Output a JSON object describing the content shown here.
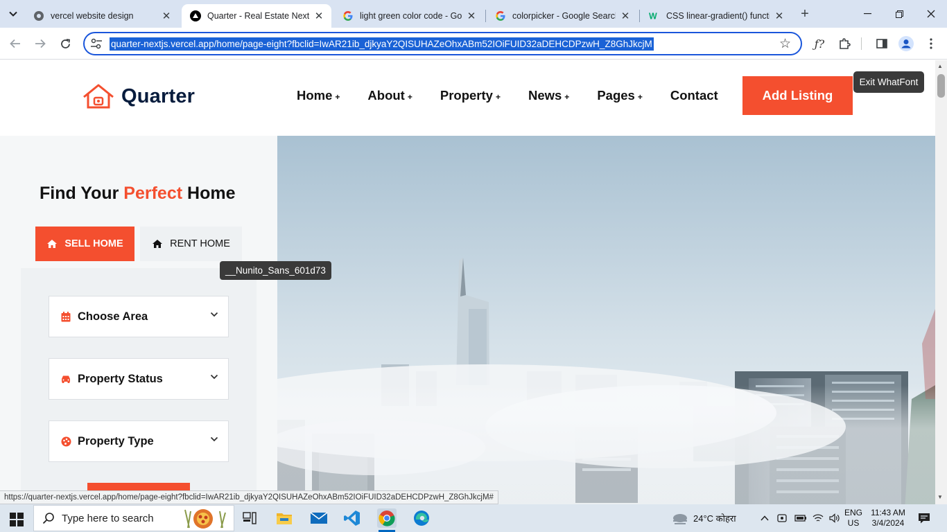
{
  "browser": {
    "tabs": [
      {
        "title": "vercel website design",
        "icon": "globe-icon",
        "active": false
      },
      {
        "title": "Quarter - Real Estate NextJs",
        "icon": "vercel-icon",
        "active": true
      },
      {
        "title": "light green color code - Goo",
        "icon": "google-icon",
        "active": false
      },
      {
        "title": "colorpicker - Google Search",
        "icon": "google-icon",
        "active": false
      },
      {
        "title": "CSS linear-gradient() functio",
        "icon": "w3schools-icon",
        "active": false
      }
    ],
    "url": "quarter-nextjs.vercel.app/home/page-eight?fbclid=IwAR21ib_djkyaY2QISUHAZeOhxABm52IOiFUID32aDEHCDPzwH_Z8GhJkcjM",
    "status_url": "https://quarter-nextjs.vercel.app/home/page-eight?fbclid=IwAR21ib_djkyaY2QISUHAZeOhxABm52IOiFUID32aDEHCDPzwH_Z8GhJkcjM#"
  },
  "site": {
    "logo_text": "Quarter",
    "nav": [
      {
        "label": "Home",
        "has_sub": true
      },
      {
        "label": "About",
        "has_sub": true
      },
      {
        "label": "Property",
        "has_sub": true
      },
      {
        "label": "News",
        "has_sub": true
      },
      {
        "label": "Pages",
        "has_sub": true
      },
      {
        "label": "Contact",
        "has_sub": false
      }
    ],
    "nav_plus": "+",
    "add_listing": "Add Listing",
    "hero": {
      "title_pre": "Find Your ",
      "title_accent": "Perfect",
      "title_post": " Home",
      "tab_sell": "SELL HOME",
      "tab_rent": "RENT HOME",
      "selects": [
        {
          "label": "Choose Area",
          "icon": "calendar-icon"
        },
        {
          "label": "Property Status",
          "icon": "car-icon"
        },
        {
          "label": "Property Type",
          "icon": "palette-icon"
        }
      ]
    },
    "accent_color": "#f44f2f",
    "dark_color": "#071c3d"
  },
  "whatfont": {
    "tooltip": "__Nunito_Sans_601d73",
    "exit": "Exit WhatFont"
  },
  "taskbar": {
    "search_placeholder": "Type here to search",
    "weather": "24°C कोहरा",
    "lang1": "ENG",
    "lang2": "US",
    "time": "11:43 AM",
    "date": "3/4/2024"
  }
}
